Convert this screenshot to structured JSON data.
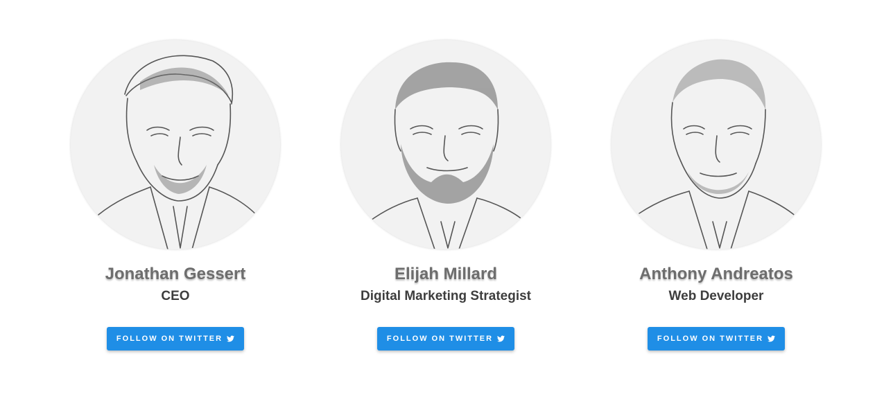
{
  "team": {
    "members": [
      {
        "name": "Jonathan Gessert",
        "role": "CEO",
        "button_label": "FOLLOW ON TWITTER",
        "button_icon": "twitter-bird-icon"
      },
      {
        "name": "Elijah Millard",
        "role": "Digital Marketing Strategist",
        "button_label": "FOLLOW ON TWITTER",
        "button_icon": "twitter-bird-icon"
      },
      {
        "name": "Anthony Andreatos",
        "role": "Web Developer",
        "button_label": "FOLLOW ON TWITTER",
        "button_icon": "twitter-bird-icon"
      }
    ]
  },
  "colors": {
    "button_bg": "#1f8ee6",
    "name_text": "#6d6d6d",
    "role_text": "#3d3d3d",
    "portrait_bg": "#f1f1f1"
  }
}
